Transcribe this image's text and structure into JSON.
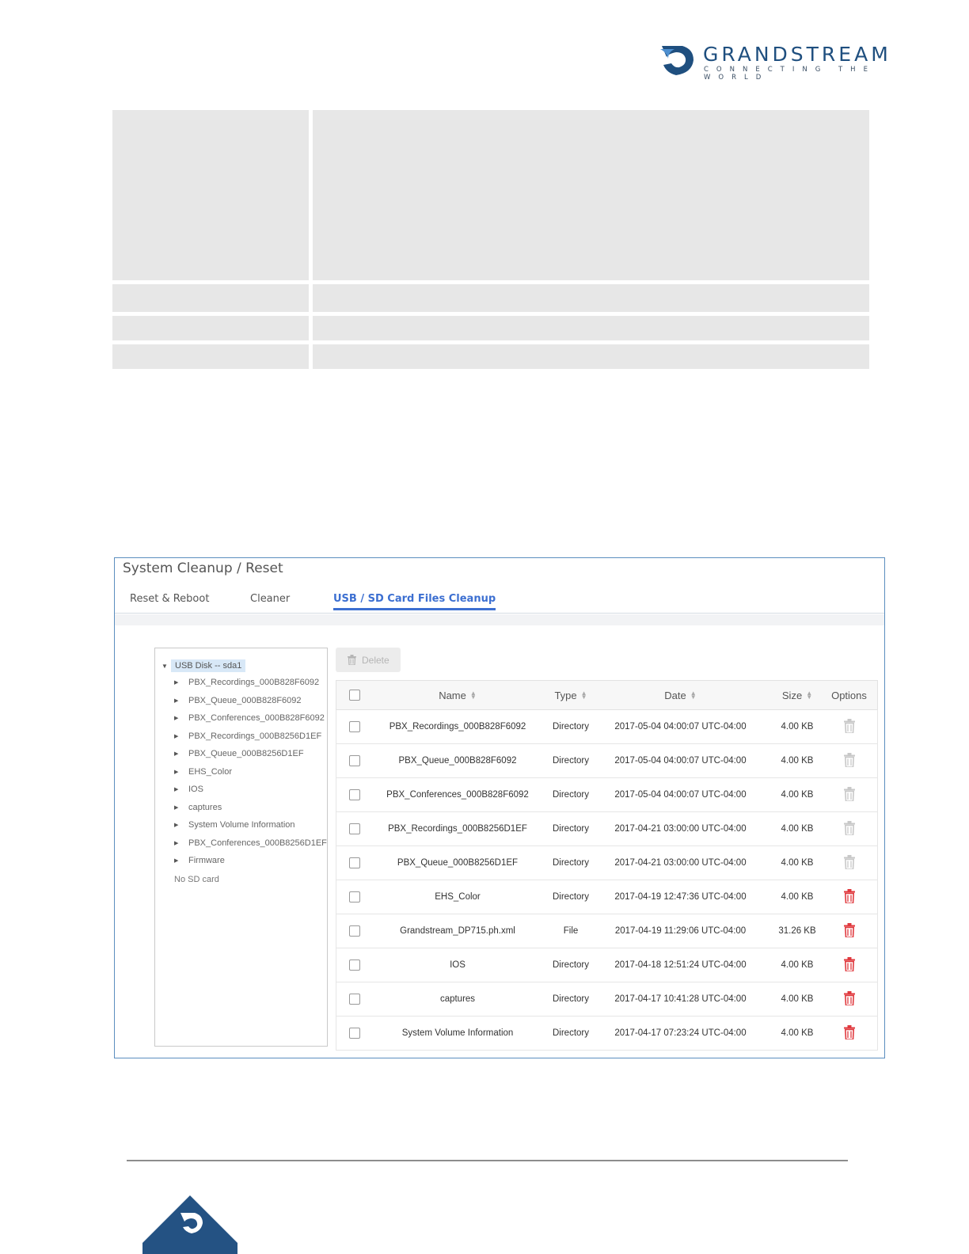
{
  "logo": {
    "brand": "GRANDSTREAM",
    "tagline": "CONNECTING THE WORLD"
  },
  "panel": {
    "title": "System Cleanup / Reset",
    "tabs": [
      {
        "label": "Reset & Reboot",
        "active": false
      },
      {
        "label": "Cleaner",
        "active": false
      },
      {
        "label": "USB / SD Card Files Cleanup",
        "active": true
      }
    ],
    "tree": {
      "root": "USB Disk -- sda1",
      "items": [
        "PBX_Recordings_000B828F6092",
        "PBX_Queue_000B828F6092",
        "PBX_Conferences_000B828F6092",
        "PBX_Recordings_000B8256D1EF",
        "PBX_Queue_000B8256D1EF",
        "EHS_Color",
        "IOS",
        "captures",
        "System Volume Information",
        "PBX_Conferences_000B8256D1EF",
        "Firmware"
      ],
      "no_sd": "No SD card"
    },
    "delete_label": "Delete",
    "table": {
      "headers": {
        "name": "Name",
        "type": "Type",
        "date": "Date",
        "size": "Size",
        "options": "Options"
      },
      "rows": [
        {
          "name": "PBX_Recordings_000B828F6092",
          "type": "Directory",
          "date": "2017-05-04 04:00:07 UTC-04:00",
          "size": "4.00 KB",
          "deletable": false
        },
        {
          "name": "PBX_Queue_000B828F6092",
          "type": "Directory",
          "date": "2017-05-04 04:00:07 UTC-04:00",
          "size": "4.00 KB",
          "deletable": false
        },
        {
          "name": "PBX_Conferences_000B828F6092",
          "type": "Directory",
          "date": "2017-05-04 04:00:07 UTC-04:00",
          "size": "4.00 KB",
          "deletable": false
        },
        {
          "name": "PBX_Recordings_000B8256D1EF",
          "type": "Directory",
          "date": "2017-04-21 03:00:00 UTC-04:00",
          "size": "4.00 KB",
          "deletable": false
        },
        {
          "name": "PBX_Queue_000B8256D1EF",
          "type": "Directory",
          "date": "2017-04-21 03:00:00 UTC-04:00",
          "size": "4.00 KB",
          "deletable": false
        },
        {
          "name": "EHS_Color",
          "type": "Directory",
          "date": "2017-04-19 12:47:36 UTC-04:00",
          "size": "4.00 KB",
          "deletable": true
        },
        {
          "name": "Grandstream_DP715.ph.xml",
          "type": "File",
          "date": "2017-04-19 11:29:06 UTC-04:00",
          "size": "31.26 KB",
          "deletable": true
        },
        {
          "name": "IOS",
          "type": "Directory",
          "date": "2017-04-18 12:51:24 UTC-04:00",
          "size": "4.00 KB",
          "deletable": true
        },
        {
          "name": "captures",
          "type": "Directory",
          "date": "2017-04-17 10:41:28 UTC-04:00",
          "size": "4.00 KB",
          "deletable": true
        },
        {
          "name": "System Volume Information",
          "type": "Directory",
          "date": "2017-04-17 07:23:24 UTC-04:00",
          "size": "4.00 KB",
          "deletable": true
        }
      ]
    }
  },
  "colors": {
    "accent": "#3c6fd1",
    "delete_active": "#e0393e",
    "delete_disabled": "#c8c8c8",
    "brand_blue": "#1f4f7f"
  },
  "icons": {
    "trash": "trash-icon",
    "caret_right": "caret-right-icon",
    "caret_down": "caret-down-icon",
    "sort": "sort-icon"
  }
}
